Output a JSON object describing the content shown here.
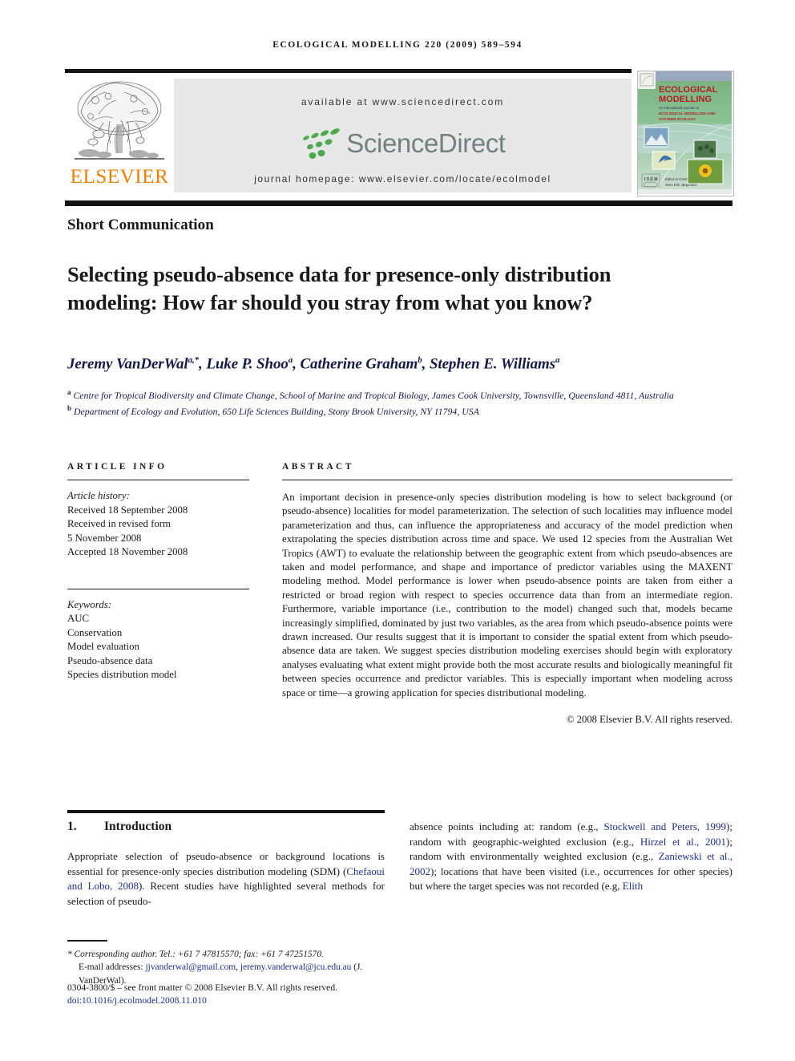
{
  "running_head": "ECOLOGICAL MODELLING 220 (2009) 589–594",
  "masthead": {
    "publisher_name": "ELSEVIER",
    "available_at": "available at www.sciencedirect.com",
    "sciencedirect_wordmark": "ScienceDirect",
    "journal_homepage": "journal homepage: www.elsevier.com/locate/ecolmodel",
    "cover": {
      "title_line1": "ECOLOGICAL",
      "title_line2": "MODELLING",
      "subtitle": "An International Journal on",
      "subtitle2": "ECOLOGICAL MODELLING AND",
      "subtitle3": "SYSTEMS ECOLOGY",
      "editor_label": "Editor-in-Chief:",
      "editor_name": "Sven Erik Jørgensen"
    }
  },
  "article_type": "Short Communication",
  "title": "Selecting pseudo-absence data for presence-only distribution modeling: How far should you stray from what you know?",
  "authors": "Jeremy VanDerWal<sup>a,*</sup>, Luke P. Shoo<sup>a</sup>, Catherine Graham<sup>b</sup>, Stephen E. Williams<sup>a</sup>",
  "affiliations": "<sup>a</sup> Centre for Tropical Biodiversity and Climate Change, School of Marine and Tropical Biology, James Cook University, Townsville, Queensland 4811, Australia<br><sup>b</sup> Department of Ecology and Evolution, 650 Life Sciences Building, Stony Brook University, NY 11794, USA",
  "article_info": {
    "heading": "ARTICLE INFO",
    "history_label": "Article history:",
    "history": [
      "Received 18 September 2008",
      "Received in revised form",
      "5 November 2008",
      "Accepted 18 November 2008"
    ],
    "keywords_label": "Keywords:",
    "keywords": [
      "AUC",
      "Conservation",
      "Model evaluation",
      "Pseudo-absence data",
      "Species distribution model"
    ]
  },
  "abstract": {
    "heading": "ABSTRACT",
    "body": "An important decision in presence-only species distribution modeling is how to select background (or pseudo-absence) localities for model parameterization. The selection of such localities may influence model parameterization and thus, can influence the appropriateness and accuracy of the model prediction when extrapolating the species distribution across time and space. We used 12 species from the Australian Wet Tropics (AWT) to evaluate the relationship between the geographic extent from which pseudo-absences are taken and model performance, and shape and importance of predictor variables using the MAXENT modeling method. Model performance is lower when pseudo-absence points are taken from either a restricted or broad region with respect to species occurrence data than from an intermediate region. Furthermore, variable importance (i.e., contribution to the model) changed such that, models became increasingly simplified, dominated by just two variables, as the area from which pseudo-absence points were drawn increased. Our results suggest that it is important to consider the spatial extent from which pseudo-absence data are taken. We suggest species distribution modeling exercises should begin with exploratory analyses evaluating what extent might provide both the most accurate results and biologically meaningful fit between species occurrence and predictor variables. This is especially important when modeling across space or time—a growing application for species distributional modeling.",
    "copyright": "© 2008 Elsevier B.V. All rights reserved."
  },
  "introduction": {
    "number": "1.",
    "heading": "Introduction",
    "left_column": "Appropriate selection of pseudo-absence or background locations is essential for presence-only species distribution modeling (SDM) (<span class=\"cit\">Chefaoui and Lobo, 2008</span>). Recent studies have highlighted several methods for selection of pseudo-",
    "right_column": "absence points including at: random (e.g., <span class=\"cit\">Stockwell and Peters, 1999</span>); random with geographic-weighted exclusion (e.g., <span class=\"cit\">Hirzel et al., 2001</span>); random with environmentally weighted exclusion (e.g., <span class=\"cit\">Zaniewski et al., 2002</span>); locations that have been visited (i.e., occurrences for other species) but where the target species was not recorded (e.g, <span class=\"cit\">Elith</span>"
  },
  "footnote": {
    "corresponding": "<span class=\"ital\">* Corresponding author. Tel.: +61 7 47815570; fax: +61 7 47251570.</span>",
    "emails": "<span class=\"indent\">E-mail addresses: <span class=\"mail\">jjvanderwal@gmail.com</span>, <span class=\"mail\">jeremy.vanderwal@jcu.edu.au</span> (J. VanDerWal).</span>",
    "issn": "0304-3800/$ – see front matter © 2008 Elsevier B.V. All rights reserved.",
    "doi": "doi:10.1016/j.ecolmodel.2008.11.010"
  },
  "colors": {
    "elsevier_orange": "#f08000",
    "author_navy": "#161a4a",
    "citation_blue": "#1e2f8c",
    "sciencedirect_green": "#4caa4c",
    "sciencedirect_gray": "#72817f",
    "band_gray": "#e8e8e8"
  }
}
